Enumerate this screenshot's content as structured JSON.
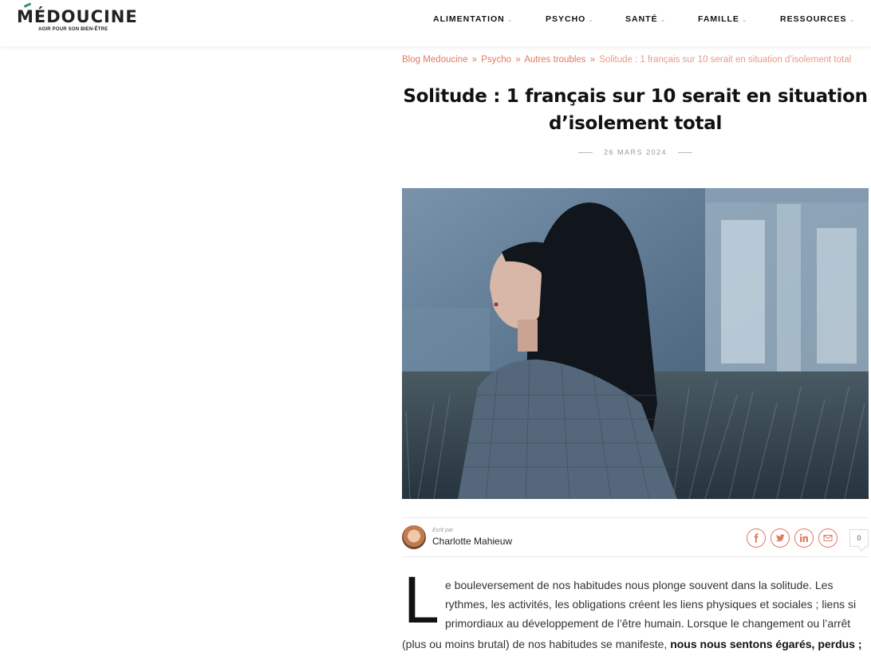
{
  "logo": {
    "name": "MÉDOUCINE",
    "tagline": "AGIR POUR SON BIEN-ÊTRE"
  },
  "nav": [
    {
      "label": "ALIMENTATION"
    },
    {
      "label": "PSYCHO"
    },
    {
      "label": "SANTÉ"
    },
    {
      "label": "FAMILLE"
    },
    {
      "label": "RESSOURCES"
    }
  ],
  "breadcrumb": {
    "items": [
      "Blog Medoucine",
      "Psycho",
      "Autres troubles"
    ],
    "separator": "»",
    "current": "Solitude : 1 français sur 10 serait en situation d’isolement total"
  },
  "article": {
    "title_line1": "Solitude : 1 français sur 10 serait en situation",
    "title_line2": "d’isolement total",
    "date": "26 MARS 2024",
    "author_prefix": "Ecrit par",
    "author": "Charlotte Mahieuw",
    "comment_count": "0",
    "share_icons": [
      "facebook-icon",
      "twitter-icon",
      "linkedin-icon",
      "email-icon"
    ],
    "dropcap": "L",
    "lines": [
      "e bouleversement de nos habitudes nous plonge souvent dans la solitude. Les",
      "rythmes, les activités, les obligations créent les liens physiques et sociales ; liens si",
      "primordiaux au développement de l’être humain. Lorsque le changement ou l’arrêt"
    ],
    "last_line_normal": "(plus ou moins brutal) de nos habitudes se manifeste, ",
    "last_line_bold": "nous nous sentons égarés, perdus ;"
  },
  "colors": {
    "accent": "#e07a5f",
    "logo_green": "#3a8f6a"
  }
}
